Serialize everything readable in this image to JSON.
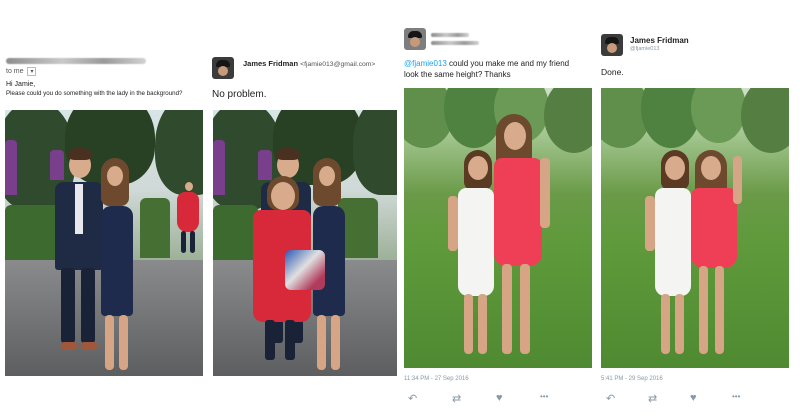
{
  "email": {
    "to_label": "to me",
    "greeting": "Hi Jamie,",
    "body": "Please could you do something with the lady in the background?"
  },
  "reply1": {
    "sender_name": "James Fridman",
    "sender_email": "<fjamie013@gmail.com>",
    "body": "No problem."
  },
  "tweet": {
    "mention": "@fjamie013",
    "text_line1": " could you make me and my friend",
    "text_line2": "look the same height? Thanks",
    "timestamp": "11:34 PM - 27 Sep 2016"
  },
  "reply2": {
    "name": "James Fridman",
    "handle": "@fjamie013",
    "body": "Done.",
    "timestamp": "5:41 PM - 29 Sep 2016"
  },
  "icons": {
    "reply": "↶",
    "retweet": "⇄",
    "like": "♥",
    "more": "•••"
  },
  "colors": {
    "link": "#1da1f2",
    "muted": "#8899a6"
  }
}
